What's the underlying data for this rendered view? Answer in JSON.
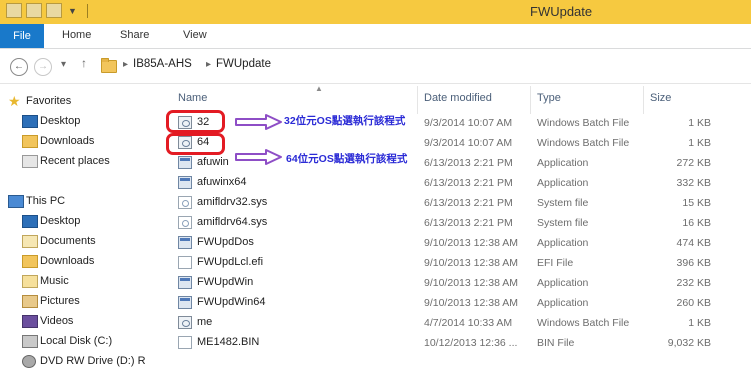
{
  "window": {
    "title": "FWUpdate"
  },
  "ribbon": {
    "tabs": [
      "File",
      "Home",
      "Share",
      "View"
    ]
  },
  "address": {
    "path": [
      "IB85A-AHS",
      "FWUpdate"
    ]
  },
  "nav": {
    "favorites_label": "Favorites",
    "favorites": [
      "Desktop",
      "Downloads",
      "Recent places"
    ],
    "thispc_label": "This PC",
    "thispc": [
      "Desktop",
      "Documents",
      "Downloads",
      "Music",
      "Pictures",
      "Videos",
      "Local Disk (C:)",
      "DVD RW Drive (D:) R"
    ]
  },
  "columns": {
    "name": "Name",
    "date": "Date modified",
    "type": "Type",
    "size": "Size"
  },
  "files": [
    {
      "name": "32",
      "date": "9/3/2014 10:07 AM",
      "type": "Windows Batch File",
      "size": "1 KB",
      "icon": "batch-icon"
    },
    {
      "name": "64",
      "date": "9/3/2014 10:07 AM",
      "type": "Windows Batch File",
      "size": "1 KB",
      "icon": "batch-icon"
    },
    {
      "name": "afuwin",
      "date": "6/13/2013 2:21 PM",
      "type": "Application",
      "size": "272 KB",
      "icon": "app-icon"
    },
    {
      "name": "afuwinx64",
      "date": "6/13/2013 2:21 PM",
      "type": "Application",
      "size": "332 KB",
      "icon": "app-icon"
    },
    {
      "name": "amifldrv32.sys",
      "date": "6/13/2013 2:21 PM",
      "type": "System file",
      "size": "15 KB",
      "icon": "sys-icon"
    },
    {
      "name": "amifldrv64.sys",
      "date": "6/13/2013 2:21 PM",
      "type": "System file",
      "size": "16 KB",
      "icon": "sys-icon"
    },
    {
      "name": "FWUpdDos",
      "date": "9/10/2013 12:38 AM",
      "type": "Application",
      "size": "474 KB",
      "icon": "app-icon"
    },
    {
      "name": "FWUpdLcl.efi",
      "date": "9/10/2013 12:38 AM",
      "type": "EFI File",
      "size": "396 KB",
      "icon": "file-icon"
    },
    {
      "name": "FWUpdWin",
      "date": "9/10/2013 12:38 AM",
      "type": "Application",
      "size": "232 KB",
      "icon": "app-icon"
    },
    {
      "name": "FWUpdWin64",
      "date": "9/10/2013 12:38 AM",
      "type": "Application",
      "size": "260 KB",
      "icon": "app-icon"
    },
    {
      "name": "me",
      "date": "4/7/2014 10:33 AM",
      "type": "Windows Batch File",
      "size": "1 KB",
      "icon": "batch-icon"
    },
    {
      "name": "ME1482.BIN",
      "date": "10/12/2013 12:36 ...",
      "type": "BIN File",
      "size": "9,032 KB",
      "icon": "file-icon"
    }
  ],
  "annotations": {
    "note32": "32位元OS點選執行該程式",
    "note64": "64位元OS點選執行該程式",
    "highlight_color": "#e31b23",
    "arrow_color": "#8e4ec6",
    "note_color": "#2b2bd6"
  }
}
